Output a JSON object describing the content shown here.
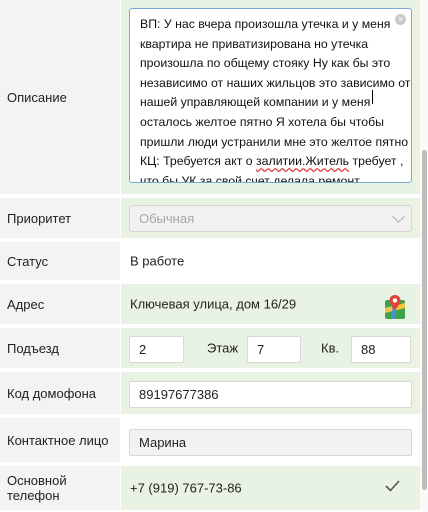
{
  "description": {
    "label": "Описание",
    "lines": [
      "ВП: У нас вчера произошла утечка и у меня",
      "квартира не приватизирована но утечка",
      "произошла по общему стояку Ну как бы это",
      "независимо от наших жильцов это зависимо от",
      "нашей управляющей компании и у меня",
      "осталось желтое пятно Я хотела бы чтобы",
      "пришли люди устранили мне это желтое пятно"
    ],
    "line8_prefix": "КЦ: Требуется акт о ",
    "line8_squiggle": "залитии.Житель",
    "line8_suffix": " требует ,",
    "line9": "что бы УК за свой счет делала ремонт.",
    "clear_glyph": "×"
  },
  "priority": {
    "label": "Приоритет",
    "value": "Обычная"
  },
  "status": {
    "label": "Статус",
    "value": "В работе"
  },
  "address": {
    "label": "Адрес",
    "value": "Ключевая улица, дом 16/29"
  },
  "entrance": {
    "label": "Подъезд",
    "value": "2",
    "floor_label": "Этаж",
    "floor_value": "7",
    "apt_label": "Кв.",
    "apt_value": "88"
  },
  "intercom": {
    "label": "Код домофона",
    "value": "89197677386"
  },
  "contact": {
    "label": "Контактное лицо",
    "value": "Марина"
  },
  "phone": {
    "label": "Основной телефон",
    "value": "+7 (919) 767-73-86"
  },
  "colors": {
    "accent": "#7aa7d6",
    "value_bg": "#e9f3e3",
    "label_bg": "#f3f3f3"
  },
  "icons": {
    "map": "map-icon",
    "check": "check-icon",
    "chevron": "chevron-down-icon"
  }
}
